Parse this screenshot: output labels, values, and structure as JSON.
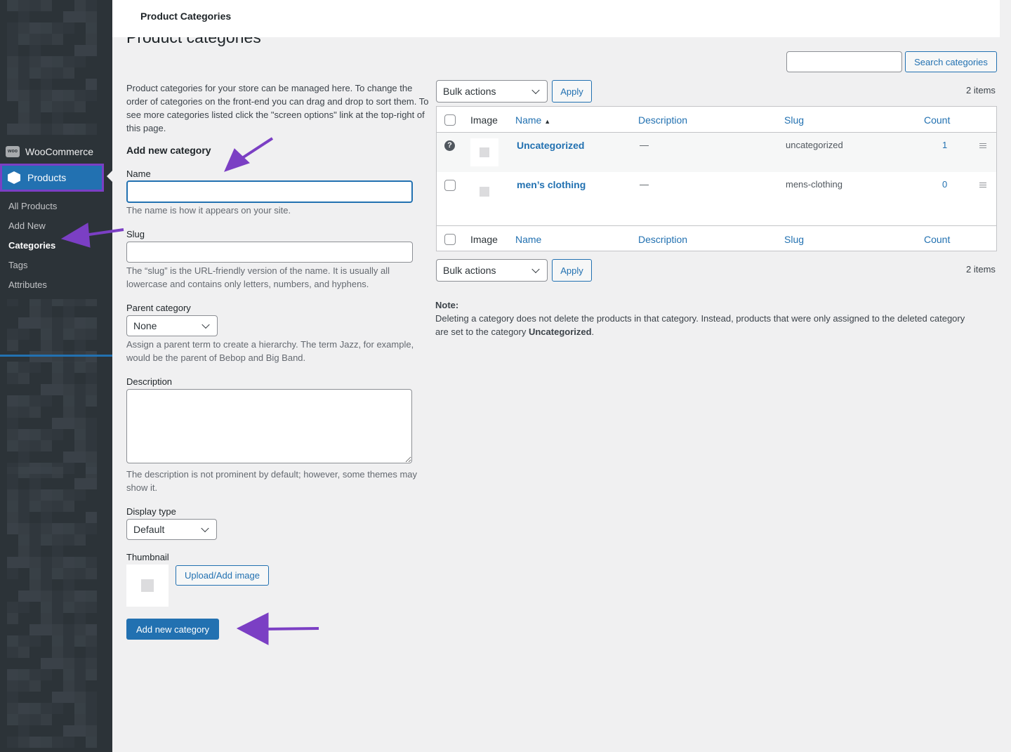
{
  "sidebar": {
    "woocommerce": "WooCommerce",
    "woo_icon_text": "woo",
    "products": "Products",
    "items": [
      {
        "label": "All Products"
      },
      {
        "label": "Add New"
      },
      {
        "label": "Categories",
        "current": true
      },
      {
        "label": "Tags"
      },
      {
        "label": "Attributes"
      }
    ]
  },
  "header": {
    "title": "Product Categories"
  },
  "page_title": "Product categories",
  "intro": "Product categories for your store can be managed here. To change the order of categories on the front-end you can drag and drop to sort them. To see more categories listed click the \"screen options\" link at the top-right of this page.",
  "form": {
    "heading": "Add new category",
    "name_label": "Name",
    "name_value": "",
    "name_help": "The name is how it appears on your site.",
    "slug_label": "Slug",
    "slug_value": "",
    "slug_help": "The “slug” is the URL-friendly version of the name. It is usually all lowercase and contains only letters, numbers, and hyphens.",
    "parent_label": "Parent category",
    "parent_value": "None",
    "parent_help": "Assign a parent term to create a hierarchy. The term Jazz, for example, would be the parent of Bebop and Big Band.",
    "desc_label": "Description",
    "desc_value": "",
    "desc_help": "The description is not prominent by default; however, some themes may show it.",
    "display_label": "Display type",
    "display_value": "Default",
    "thumb_label": "Thumbnail",
    "upload_label": "Upload/Add image",
    "submit_label": "Add new category"
  },
  "search": {
    "value": "",
    "button": "Search categories"
  },
  "bulk": {
    "label": "Bulk actions",
    "apply": "Apply",
    "count": "2 items"
  },
  "table": {
    "columns": {
      "image": "Image",
      "name": "Name",
      "description": "Description",
      "slug": "Slug",
      "count": "Count"
    },
    "rows": [
      {
        "name": "Uncategorized",
        "description": "—",
        "slug": "uncategorized",
        "count": "1"
      },
      {
        "name": "men’s clothing",
        "description": "—",
        "slug": "mens-clothing",
        "count": "0"
      }
    ]
  },
  "note": {
    "title": "Note:",
    "text_before": "Deleting a category does not delete the products in that category. Instead, products that were only assigned to the deleted category are set to the category ",
    "bold": "Uncategorized",
    "text_after": "."
  },
  "colors": {
    "accent": "#2271b1",
    "annotation": "#7b3fc4",
    "sidebar": "#2c3338"
  }
}
